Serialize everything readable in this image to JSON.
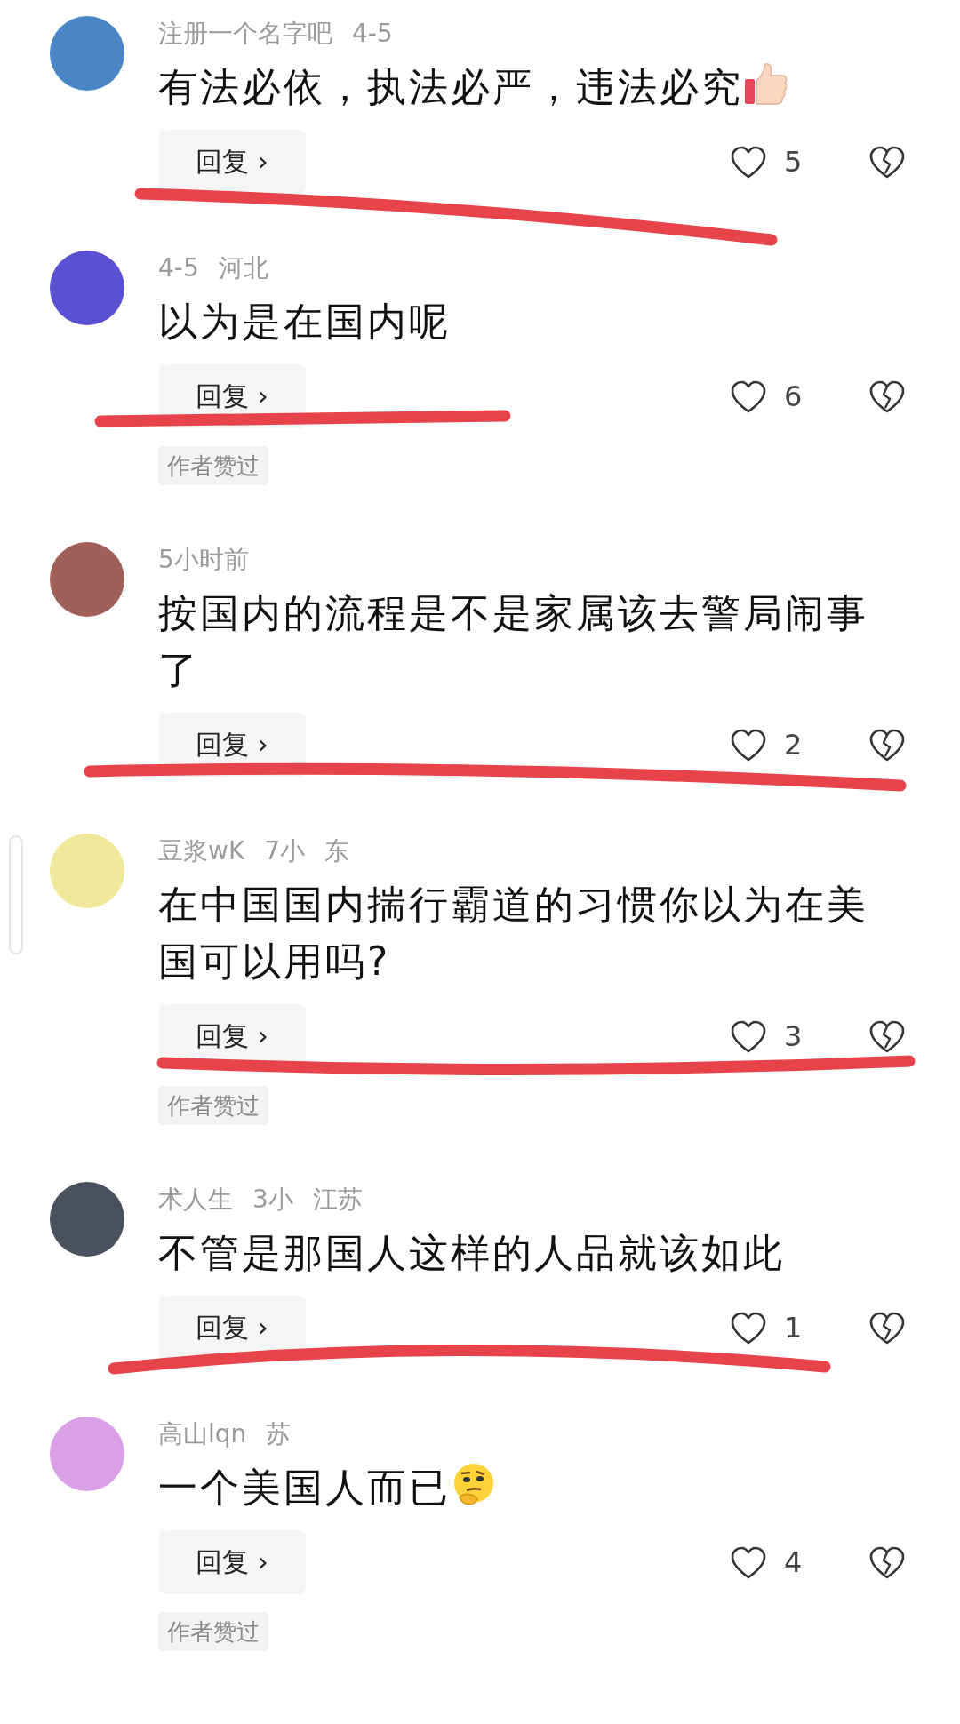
{
  "comments": [
    {
      "author": "注册一个名字吧",
      "time": "4-5",
      "text": "有法必依，执法必严，违法必究",
      "sticker": {
        "kind": "thumbs-up"
      },
      "color": "#4a86c5",
      "reply": "回复 ›",
      "likes": "5",
      "underlined": true
    },
    {
      "time": "4-5",
      "location": "河北",
      "text": "以为是在国内呢",
      "color": "#5b50d2",
      "reply": "回复 ›",
      "likes": "6",
      "underlined": true,
      "tag": "作者赞过"
    },
    {
      "time": "5小时前",
      "text": "按国内的流程是不是家属该去警局闹事了",
      "color": "#a0605a",
      "reply": "回复 ›",
      "likes": "2",
      "underlined": true
    },
    {
      "author": "豆浆wK",
      "time": "7小",
      "location": "东",
      "text": "在中国国内揣行霸道的习惯你以为在美国可以用吗?",
      "color": "#f0e89a",
      "reply": "回复 ›",
      "likes": "3",
      "underlined": true,
      "tag": "作者赞过"
    },
    {
      "author": "术人生",
      "time": "3小",
      "location": "江苏",
      "text": "不管是那国人这样的人品就该如此",
      "color": "#4a505c",
      "reply": "回复 ›",
      "likes": "1",
      "underlined": true
    },
    {
      "author": "高山lqn",
      "location": "苏",
      "text": "一个美国人而已",
      "sticker": {
        "kind": "thinking"
      },
      "color": "#d9a0e6",
      "reply": "回复 ›",
      "likes": "4",
      "underlined": false,
      "tag": "作者赞过"
    }
  ]
}
